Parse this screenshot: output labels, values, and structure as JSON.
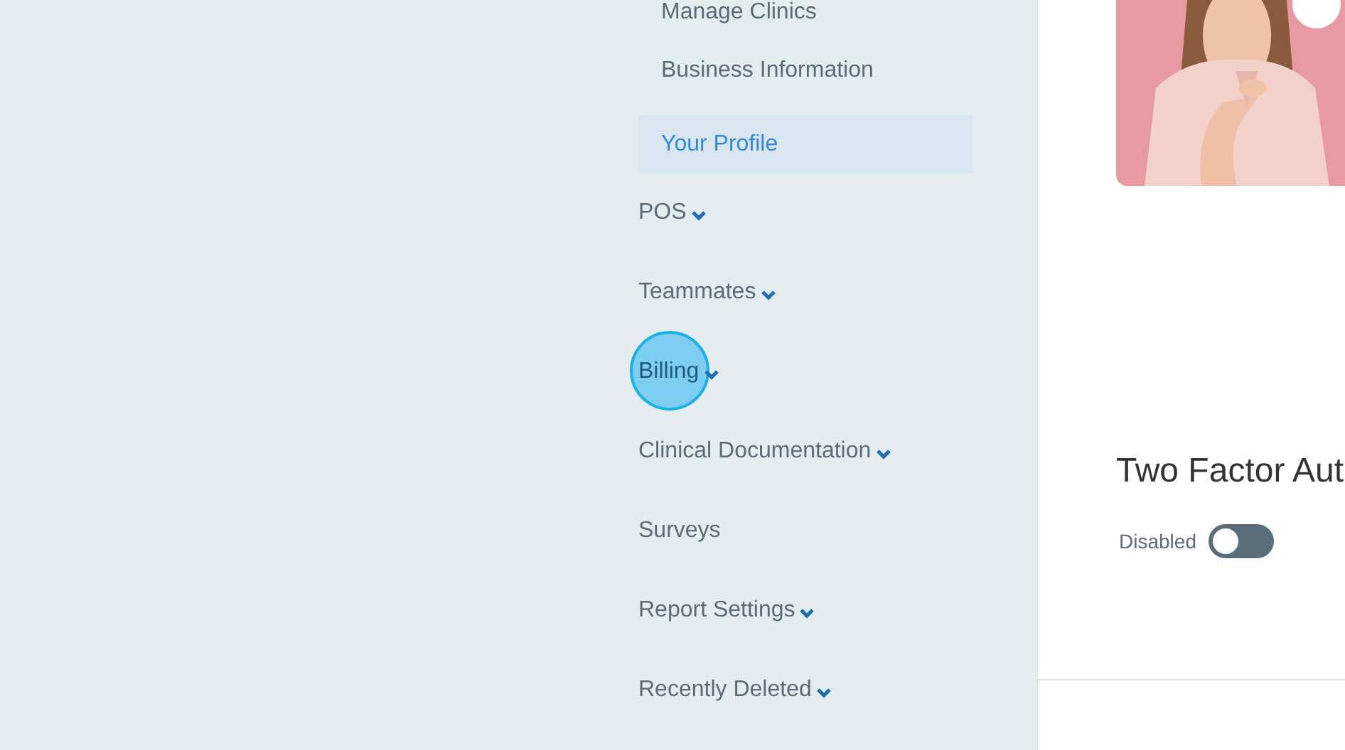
{
  "sidebar": {
    "sub_items": [
      {
        "label": "Manage Clinics",
        "selected": false
      },
      {
        "label": "Business Information",
        "selected": false
      },
      {
        "label": "Your Profile",
        "selected": true
      }
    ],
    "items": [
      {
        "label": "POS",
        "expandable": true,
        "highlighted": false
      },
      {
        "label": "Teammates",
        "expandable": true,
        "highlighted": false
      },
      {
        "label": "Billing",
        "expandable": true,
        "highlighted": true
      },
      {
        "label": "Clinical Documentation",
        "expandable": true,
        "highlighted": false
      },
      {
        "label": "Surveys",
        "expandable": false,
        "highlighted": false
      },
      {
        "label": "Report Settings",
        "expandable": true,
        "highlighted": false
      },
      {
        "label": "Recently Deleted",
        "expandable": true,
        "highlighted": false
      }
    ]
  },
  "profile": {
    "two_factor": {
      "title": "Two Factor Aut",
      "status": "Disabled",
      "on": false
    }
  }
}
